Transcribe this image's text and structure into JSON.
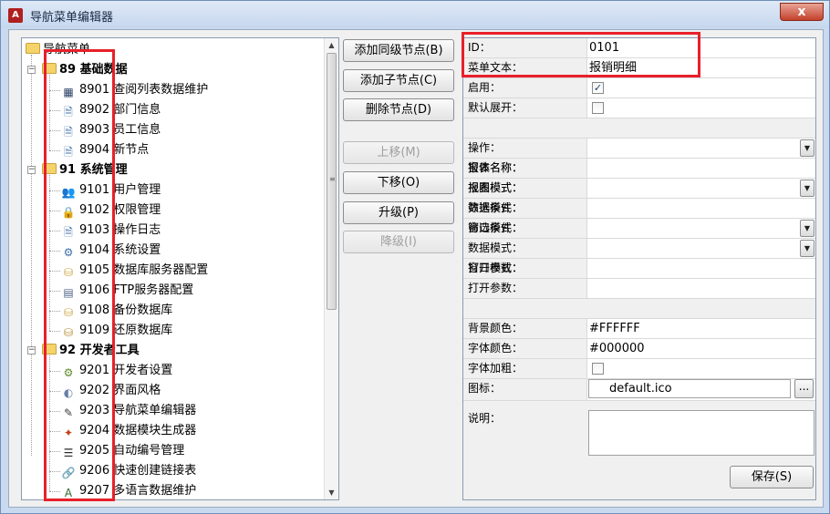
{
  "window": {
    "title": "导航菜单编辑器",
    "app_icon_text": "A",
    "close_glyph": "x"
  },
  "tree": {
    "root_label": "导航菜单",
    "groups": [
      {
        "label": "89 基础数据",
        "expander": "−",
        "items": [
          {
            "code": "8901",
            "name": "查阅列表数据维护",
            "icon": "grid-icon"
          },
          {
            "code": "8902",
            "name": "部门信息",
            "icon": "document-icon"
          },
          {
            "code": "8903",
            "name": "员工信息",
            "icon": "document-icon"
          },
          {
            "code": "8904",
            "name": "新节点",
            "icon": "document-icon"
          }
        ]
      },
      {
        "label": "91 系统管理",
        "expander": "−",
        "items": [
          {
            "code": "9101",
            "name": "用户管理",
            "icon": "users-icon"
          },
          {
            "code": "9102",
            "name": "权限管理",
            "icon": "lock-icon"
          },
          {
            "code": "9103",
            "name": "操作日志",
            "icon": "document-icon"
          },
          {
            "code": "9104",
            "name": "系统设置",
            "icon": "settings-icon"
          },
          {
            "code": "9105",
            "name": "数据库服务器配置",
            "icon": "database-config-icon"
          },
          {
            "code": "9106",
            "name": "FTP服务器配置",
            "icon": "server-icon"
          },
          {
            "code": "9108",
            "name": "备份数据库",
            "icon": "backup-icon"
          },
          {
            "code": "9109",
            "name": "还原数据库",
            "icon": "restore-icon"
          }
        ]
      },
      {
        "label": "92 开发者工具",
        "expander": "−",
        "items": [
          {
            "code": "9201",
            "name": "开发者设置",
            "icon": "developer-settings-icon"
          },
          {
            "code": "9202",
            "name": "界面风格",
            "icon": "theme-icon"
          },
          {
            "code": "9203",
            "name": "导航菜单编辑器",
            "icon": "edit-icon"
          },
          {
            "code": "9204",
            "name": "数据模块生成器",
            "icon": "wand-icon"
          },
          {
            "code": "9205",
            "name": "自动编号管理",
            "icon": "numbered-list-icon"
          },
          {
            "code": "9206",
            "name": "快速创建链接表",
            "icon": "link-icon"
          },
          {
            "code": "9207",
            "name": "多语言数据维护",
            "icon": "language-icon"
          }
        ]
      }
    ]
  },
  "buttons": {
    "add_sibling": "添加同级节点(B)",
    "add_child": "添加子节点(C)",
    "delete_node": "删除节点(D)",
    "move_up": "上移(M)",
    "move_down": "下移(O)",
    "promote": "升级(P)",
    "demote": "降级(I)",
    "save": "保存(S)",
    "browse": "..."
  },
  "properties": {
    "id_label": "ID：",
    "id_value": "0101",
    "menu_text_label": "菜单文本：",
    "menu_text_value": "报销明细",
    "enabled_label": "启用：",
    "enabled_checked": true,
    "expand_label": "默认展开：",
    "expand_checked": false,
    "action_label": "操作：",
    "row_a_labels": [
      "窗体名称：",
      "报表名称："
    ],
    "row_b_labels": [
      "视图模式：",
      "报表模式："
    ],
    "row_c_labels": [
      "筛选条件：",
      "数据模式："
    ],
    "row_d_labels": [
      "窗口模式：",
      "筛选条件："
    ],
    "data_mode_label": "数据模式：",
    "row_e_labels": [
      "打开参数：",
      "窗口模式："
    ],
    "open_params_label": "打开参数：",
    "bg_color_label": "背景颜色：",
    "bg_color_value": "#FFFFFF",
    "font_color_label": "字体颜色：",
    "font_color_value": "#000000",
    "bold_label": "字体加粗：",
    "bold_checked": false,
    "icon_label": "图标：",
    "icon_value": "default.ico",
    "description_label": "说明："
  },
  "colors": {
    "highlight_border": "#e8202a",
    "folder": "#f5d36b"
  }
}
